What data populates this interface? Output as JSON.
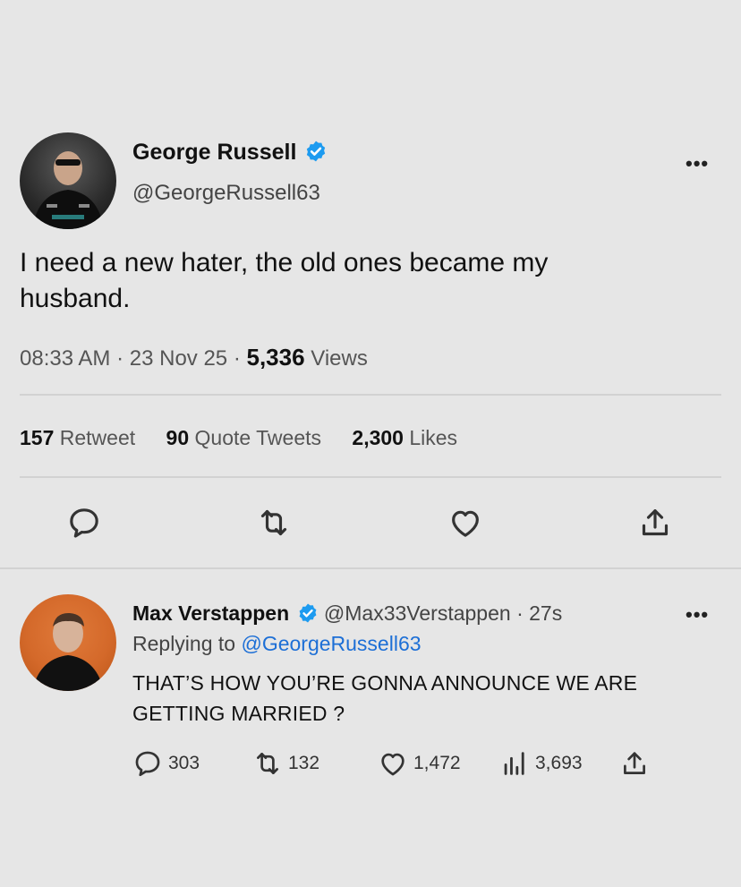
{
  "main_tweet": {
    "author_name": "George Russell",
    "author_handle": "@GeorgeRussell63",
    "text": "I need a new hater, the old ones became my husband.",
    "time": "08:33 AM",
    "date": "23 Nov 25",
    "views_count": "5,336",
    "views_label": "Views",
    "retweets_count": "157",
    "retweets_label": "Retweet",
    "quotes_count": "90",
    "quotes_label": "Quote Tweets",
    "likes_count": "2,300",
    "likes_label": "Likes",
    "more_label": "•••"
  },
  "reply": {
    "author_name": "Max Verstappen",
    "author_handle": "@Max33Verstappen",
    "age": "27s",
    "replying_to_label": "Replying to",
    "replying_to_handle": "@GeorgeRussell63",
    "text": "THAT’S HOW YOU’RE GONNA ANNOUNCE WE ARE GETTING MARRIED ?",
    "replies": "303",
    "retweets": "132",
    "likes": "1,472",
    "views": "3,693",
    "more_label": "•••"
  },
  "colors": {
    "background": "#e6e6e6",
    "verified": "#1d9bf0",
    "link": "#1d6fd6",
    "avatar_reply_bg": "#d4692a"
  },
  "icons": [
    "reply-icon",
    "retweet-icon",
    "like-icon",
    "share-icon",
    "views-icon",
    "verified-icon",
    "more-icon"
  ]
}
